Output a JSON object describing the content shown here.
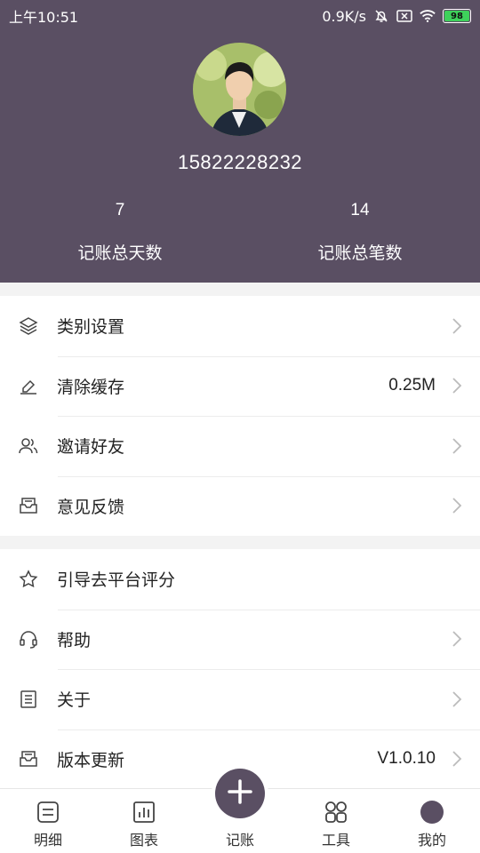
{
  "status_bar": {
    "time": "上午10:51",
    "net_speed": "0.9K/s",
    "battery": "98"
  },
  "profile": {
    "phone": "15822228232",
    "stats": [
      {
        "value": "7",
        "label": "记账总天数"
      },
      {
        "value": "14",
        "label": "记账总笔数"
      }
    ]
  },
  "menu_group_1": [
    {
      "label": "类别设置",
      "value": "",
      "icon": "layers-icon"
    },
    {
      "label": "清除缓存",
      "value": "0.25M",
      "icon": "eraser-icon"
    },
    {
      "label": "邀请好友",
      "value": "",
      "icon": "users-icon"
    },
    {
      "label": "意见反馈",
      "value": "",
      "icon": "inbox-icon"
    }
  ],
  "menu_group_2": [
    {
      "label": "引导去平台评分",
      "value": "",
      "icon": "star-icon"
    },
    {
      "label": "帮助",
      "value": "",
      "icon": "headset-icon"
    },
    {
      "label": "关于",
      "value": "",
      "icon": "document-icon"
    },
    {
      "label": "版本更新",
      "value": "V1.0.10",
      "icon": "inbox-icon"
    }
  ],
  "tabbar": [
    {
      "label": "明细",
      "icon": "list-icon"
    },
    {
      "label": "图表",
      "icon": "chart-icon"
    },
    {
      "label": "记账",
      "icon": "plus-icon"
    },
    {
      "label": "工具",
      "icon": "grid-icon"
    },
    {
      "label": "我的",
      "icon": "profile-icon"
    }
  ],
  "colors": {
    "header_bg": "#5a4f63",
    "active_tab": "#5a4f63",
    "battery_fill": "#3ed15b"
  }
}
